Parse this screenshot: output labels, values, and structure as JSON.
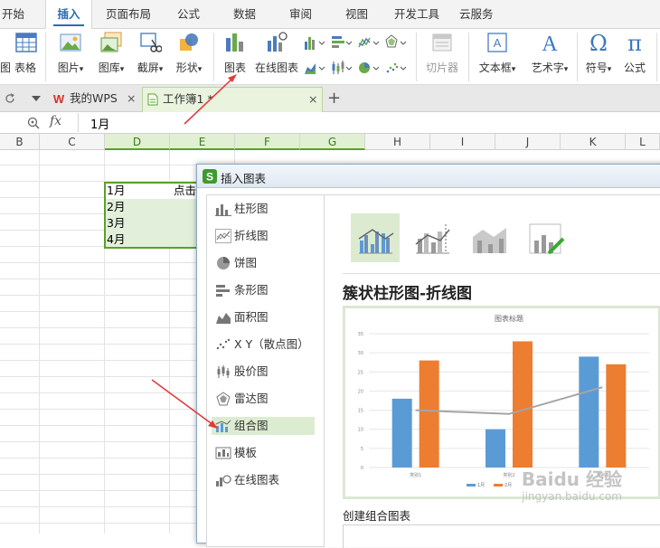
{
  "menu": {
    "tabs": [
      "开始",
      "插入",
      "页面布局",
      "公式",
      "数据",
      "审阅",
      "视图",
      "开发工具",
      "云服务"
    ],
    "active": "插入"
  },
  "ribbon": {
    "tail_label": "图",
    "table": "表格",
    "picture": "图片",
    "gallery": "图库",
    "screenshot": "截屏",
    "shape": "形状",
    "chart": "图表",
    "online_chart": "在线图表",
    "slicer": "切片器",
    "textbox": "文本框",
    "wordart": "艺术字",
    "symbol": "符号",
    "formula": "公式",
    "dropdown_mark": "▾"
  },
  "docbar": {
    "wps_tab": "我的WPS",
    "workbook_tab": "工作簿1 *",
    "close": "×",
    "new_tab": "+"
  },
  "formula_bar": {
    "fx": "fx",
    "content": "1月"
  },
  "columns": [
    "B",
    "C",
    "D",
    "E",
    "F",
    "G",
    "H",
    "I",
    "J",
    "K",
    "L"
  ],
  "cells": {
    "d1": "1月",
    "d2": "2月",
    "d3": "3月",
    "d4": "4月",
    "e1": "点击"
  },
  "dialog": {
    "title": "插入图表",
    "chart_types": [
      "柱形图",
      "折线图",
      "饼图",
      "条形图",
      "面积图",
      "X Y（散点图）",
      "股价图",
      "雷达图",
      "组合图",
      "模板",
      "在线图表"
    ],
    "active_type": "组合图",
    "subtype_title": "簇状柱形图-折线图",
    "create_label": "创建组合图表",
    "colors": {
      "accent_green": "#5aa02c",
      "bar_blue": "#5b9bd5",
      "bar_orange": "#ed7d31",
      "line_gray": "#a5a5a5"
    }
  },
  "chart_data": {
    "type": "bar",
    "title": "图表标题",
    "categories": [
      "类别1",
      "类别2",
      "类别3"
    ],
    "series": [
      {
        "name": "1月",
        "values": [
          18,
          10,
          29
        ],
        "kind": "bar"
      },
      {
        "name": "2月",
        "values": [
          28,
          33,
          27
        ],
        "kind": "bar"
      },
      {
        "values": [
          15,
          14,
          21
        ],
        "kind": "line"
      }
    ],
    "yticks": [
      "0",
      "5",
      "10",
      "15",
      "20",
      "25",
      "30",
      "35"
    ],
    "ylim": [
      0,
      35
    ],
    "legend": [
      "1月",
      "2月"
    ]
  },
  "watermark": {
    "main": "Baidu 经验",
    "sub": "jingyan.baidu.com"
  }
}
